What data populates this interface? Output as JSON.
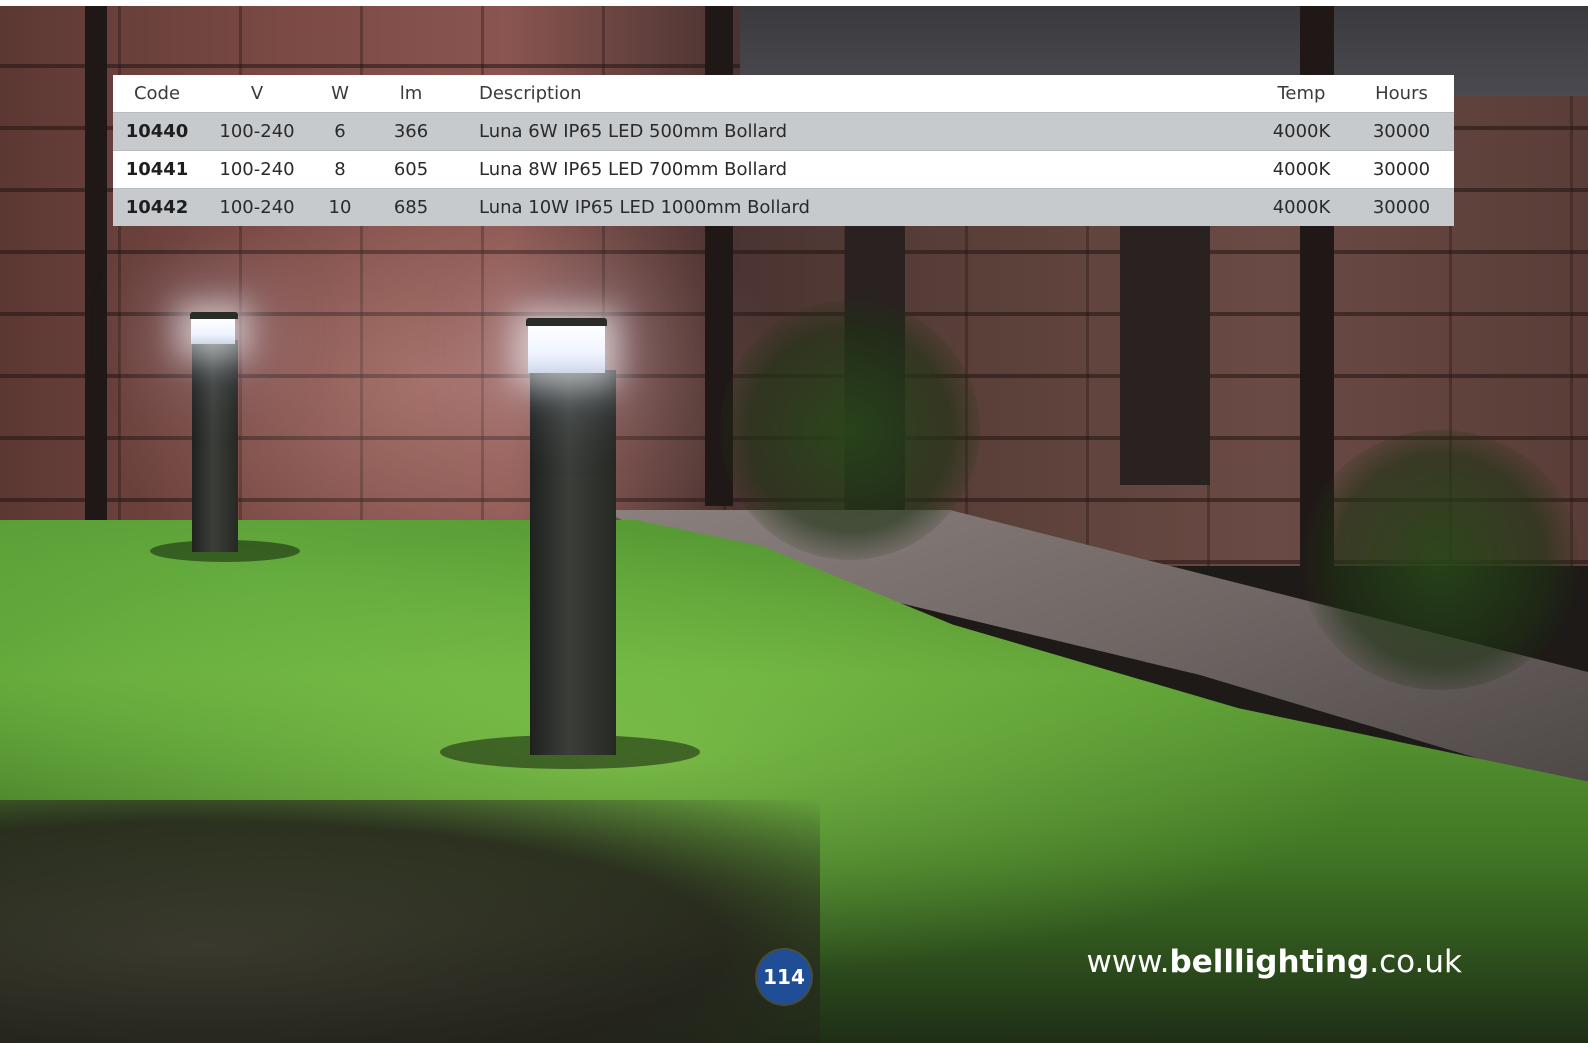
{
  "table": {
    "headers": {
      "code": "Code",
      "v": "V",
      "w": "W",
      "lm": "lm",
      "description": "Description",
      "temp": "Temp",
      "hours": "Hours"
    },
    "rows": [
      {
        "code": "10440",
        "v": "100-240",
        "w": "6",
        "lm": "366",
        "description": "Luna 6W IP65 LED 500mm Bollard",
        "temp": "4000K",
        "hours": "30000"
      },
      {
        "code": "10441",
        "v": "100-240",
        "w": "8",
        "lm": "605",
        "description": "Luna 8W IP65 LED 700mm Bollard",
        "temp": "4000K",
        "hours": "30000"
      },
      {
        "code": "10442",
        "v": "100-240",
        "w": "10",
        "lm": "685",
        "description": "Luna 10W IP65 LED 1000mm Bollard",
        "temp": "4000K",
        "hours": "30000"
      }
    ]
  },
  "footer": {
    "page_number": "114",
    "website_prefix": "www.",
    "website_brand": "belllighting",
    "website_suffix": ".co.uk",
    "badge_color": "#1f4d96"
  },
  "photo": {
    "subject": "bollard-lights-photo"
  }
}
